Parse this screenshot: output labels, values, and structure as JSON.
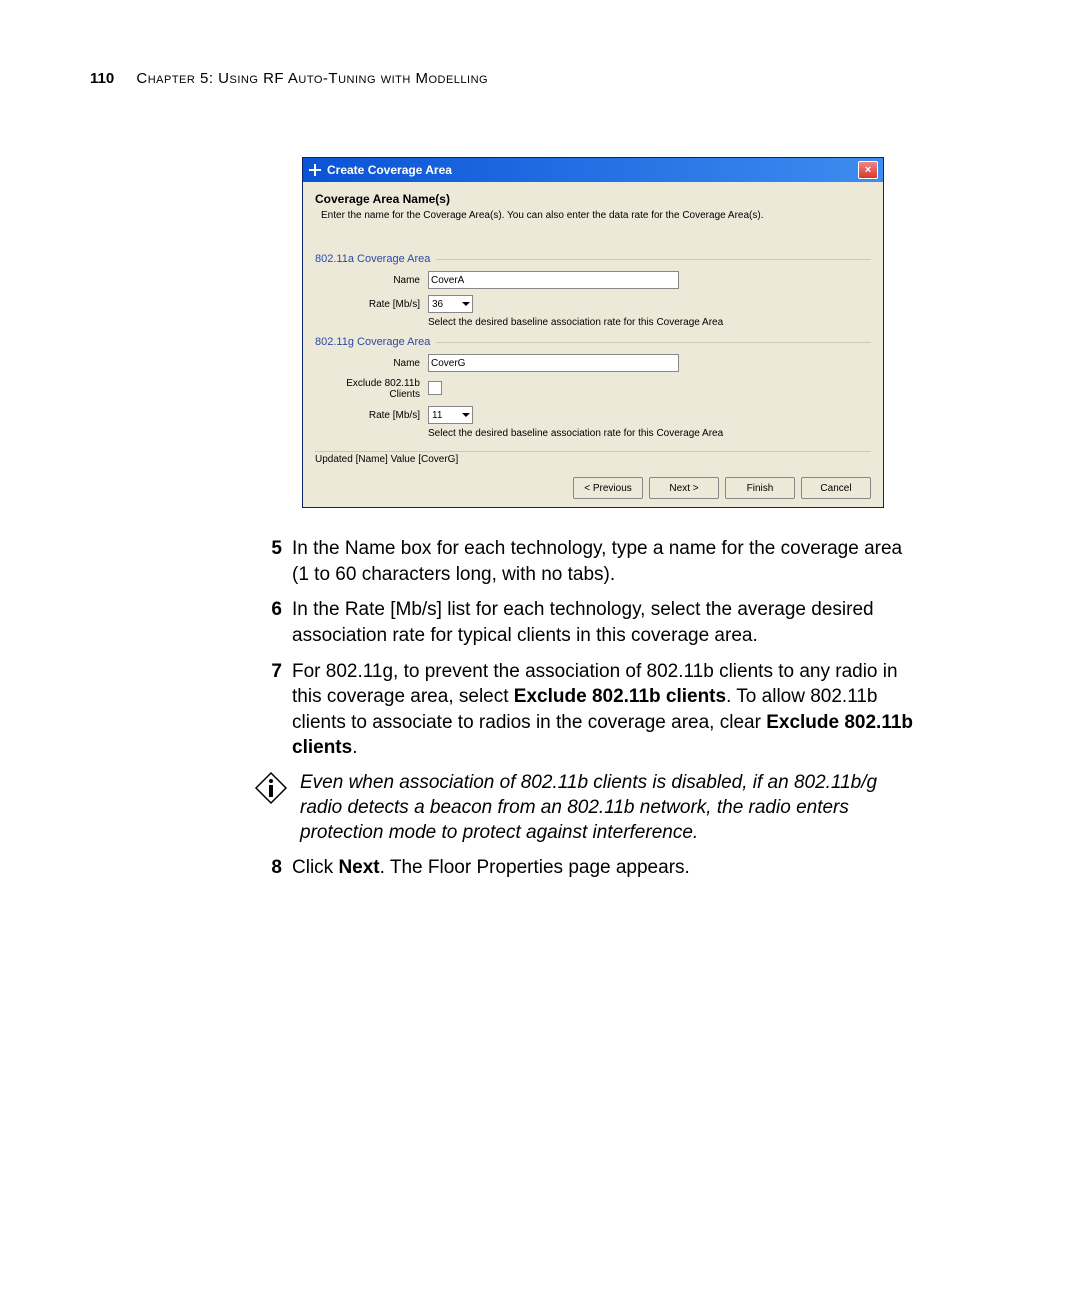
{
  "header": {
    "page_number": "110",
    "chapter_text": "Chapter 5: Using RF Auto-Tuning with Modelling"
  },
  "dialog": {
    "title": "Create Coverage Area",
    "close_glyph": "×",
    "section_title": "Coverage Area Name(s)",
    "section_desc": "Enter the name for the Coverage Area(s). You can also enter the data rate for the Coverage Area(s).",
    "group_a": {
      "legend": "802.11a Coverage Area",
      "name_label": "Name",
      "name_value": "CoverA",
      "rate_label": "Rate [Mb/s]",
      "rate_value": "36",
      "rate_help": "Select the desired baseline association rate for this Coverage Area"
    },
    "group_g": {
      "legend": "802.11g Coverage Area",
      "name_label": "Name",
      "name_value": "CoverG",
      "exclude_label": "Exclude 802.11b Clients",
      "rate_label": "Rate [Mb/s]",
      "rate_value": "11",
      "rate_help": "Select the desired baseline association rate for this Coverage Area"
    },
    "status_line": "Updated [Name] Value [CoverG]",
    "buttons": {
      "previous": "< Previous",
      "next": "Next >",
      "finish": "Finish",
      "cancel": "Cancel"
    }
  },
  "steps": {
    "s5_num": "5",
    "s5_text": "In the Name box for each technology, type a name for the coverage area (1 to 60 characters long, with no tabs).",
    "s6_num": "6",
    "s6_text": "In the Rate [Mb/s] list for each technology, select the average desired association rate for typical clients in this coverage area.",
    "s7_num": "7",
    "s7_a": "For 802.11g, to prevent the association of 802.11b clients to any radio in this coverage area, select ",
    "s7_bold1": "Exclude 802.11b clients",
    "s7_b": ". To allow 802.11b clients to associate to radios in the coverage area, clear ",
    "s7_bold2": "Exclude 802.11b clients",
    "s7_c": ".",
    "note": "Even when association of 802.11b clients is disabled, if an 802.11b/g radio detects a beacon from an 802.11b network, the radio enters protection mode to protect against interference.",
    "s8_num": "8",
    "s8_a": "Click ",
    "s8_bold": "Next",
    "s8_b": ". The Floor Properties page appears."
  }
}
